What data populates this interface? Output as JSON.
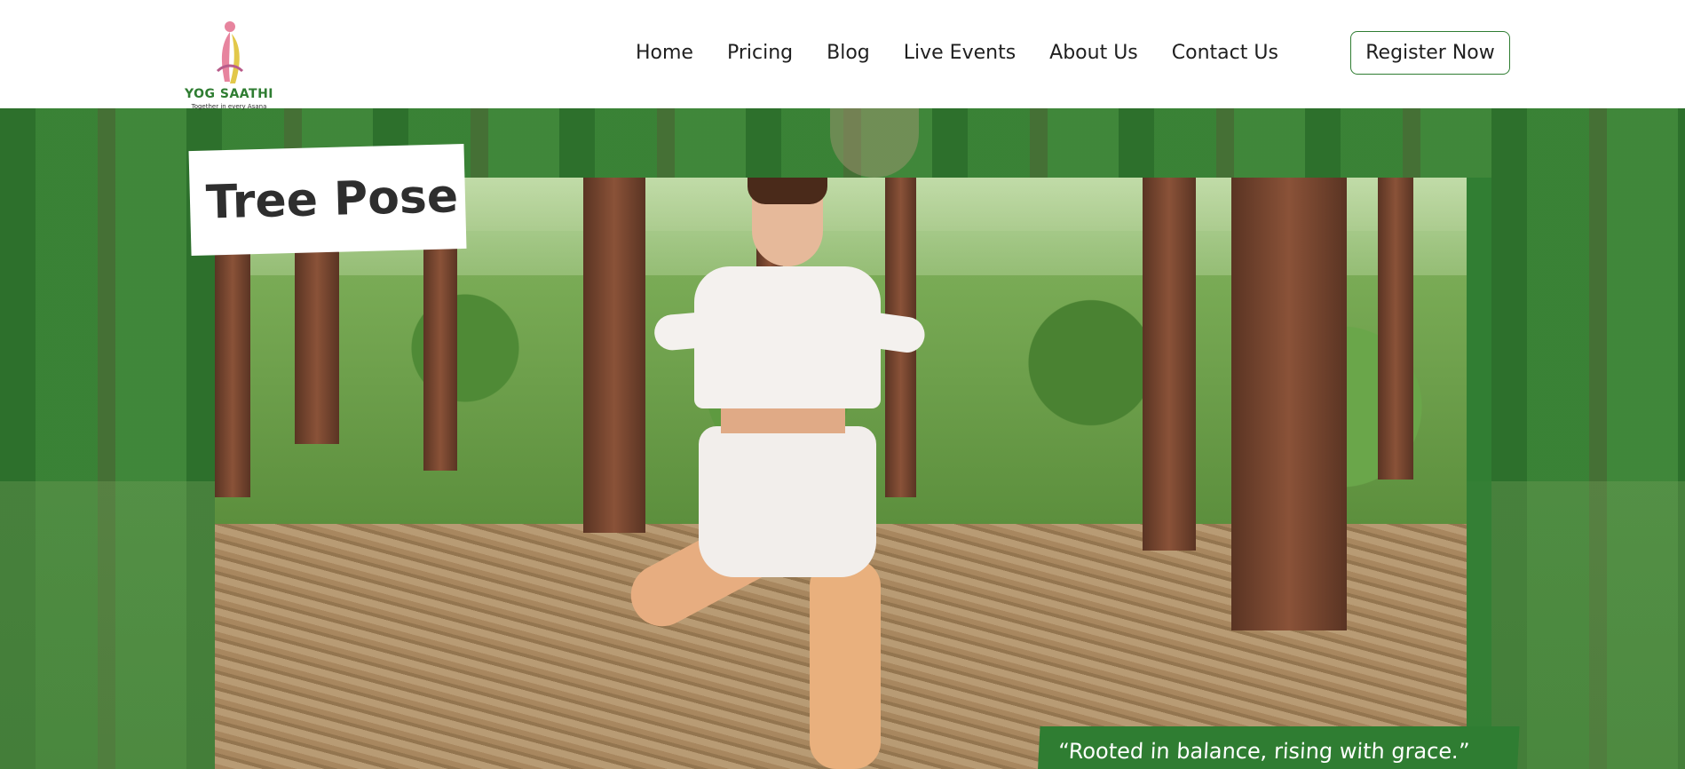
{
  "brand": {
    "name": "YOG SAATHI",
    "tagline": "Together in every Asana",
    "colors": {
      "green": "#2f7d32",
      "pink": "#e7849e",
      "yellow": "#e2c84a"
    }
  },
  "nav": {
    "items": [
      {
        "label": "Home"
      },
      {
        "label": "Pricing"
      },
      {
        "label": "Blog"
      },
      {
        "label": "Live Events"
      },
      {
        "label": "About Us"
      },
      {
        "label": "Contact Us"
      }
    ],
    "register_label": "Register Now"
  },
  "hero": {
    "title": "Tree Pose",
    "quote": "“Rooted in balance, rising with grace.”"
  }
}
